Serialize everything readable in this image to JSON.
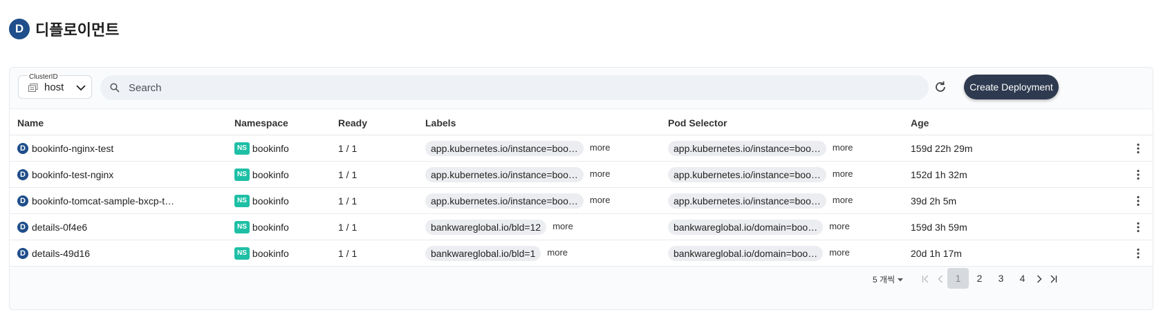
{
  "page": {
    "title": "디플로이먼트",
    "icon_letter": "D"
  },
  "toolbar": {
    "cluster_caption": "ClusterID",
    "cluster_value": "host",
    "search_placeholder": "Search",
    "search_value": "",
    "create_label": "Create Deployment"
  },
  "table": {
    "columns": [
      "Name",
      "Namespace",
      "Ready",
      "Labels",
      "Pod Selector",
      "Age"
    ],
    "more_label": "more",
    "ns_badge": "NS",
    "rows": [
      {
        "name": "bookinfo-nginx-test",
        "namespace": "bookinfo",
        "ready": "1 / 1",
        "label": "app.kubernetes.io/instance=boo…",
        "selector": "app.kubernetes.io/instance=boo…",
        "age": "159d 22h 29m"
      },
      {
        "name": "bookinfo-test-nginx",
        "namespace": "bookinfo",
        "ready": "1 / 1",
        "label": "app.kubernetes.io/instance=boo…",
        "selector": "app.kubernetes.io/instance=boo…",
        "age": "152d 1h 32m"
      },
      {
        "name": "bookinfo-tomcat-sample-bxcp-t…",
        "namespace": "bookinfo",
        "ready": "1 / 1",
        "label": "app.kubernetes.io/instance=boo…",
        "selector": "app.kubernetes.io/instance=boo…",
        "age": "39d 2h 5m"
      },
      {
        "name": "details-0f4e6",
        "namespace": "bookinfo",
        "ready": "1 / 1",
        "label": "bankwareglobal.io/bld=12",
        "selector": "bankwareglobal.io/domain=boo…",
        "age": "159d 3h 59m"
      },
      {
        "name": "details-49d16",
        "namespace": "bookinfo",
        "ready": "1 / 1",
        "label": "bankwareglobal.io/bld=1",
        "selector": "bankwareglobal.io/domain=boo…",
        "age": "20d 1h 17m"
      }
    ]
  },
  "pagination": {
    "page_size_label": "5 개씩",
    "pages": [
      "1",
      "2",
      "3",
      "4"
    ],
    "current_page": "1"
  },
  "colors": {
    "brand_badge": "#1f4e8a",
    "ns_badge": "#1ebfa5",
    "primary_button": "#2e3a4f"
  }
}
